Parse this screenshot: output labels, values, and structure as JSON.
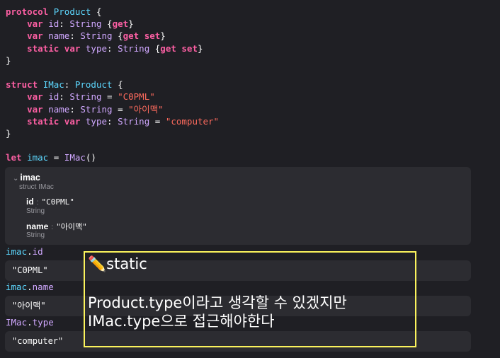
{
  "code_lines": [
    [
      [
        "kw",
        "protocol"
      ],
      [
        "plain",
        " "
      ],
      [
        "type",
        "Product"
      ],
      [
        "plain",
        " {"
      ]
    ],
    [
      [
        "plain",
        "    "
      ],
      [
        "kw",
        "var"
      ],
      [
        "plain",
        " "
      ],
      [
        "prop",
        "id"
      ],
      [
        "plain",
        ": "
      ],
      [
        "prop",
        "String"
      ],
      [
        "plain",
        " {"
      ],
      [
        "kw",
        "get"
      ],
      [
        "plain",
        "}"
      ]
    ],
    [
      [
        "plain",
        "    "
      ],
      [
        "kw",
        "var"
      ],
      [
        "plain",
        " "
      ],
      [
        "prop",
        "name"
      ],
      [
        "plain",
        ": "
      ],
      [
        "prop",
        "String"
      ],
      [
        "plain",
        " {"
      ],
      [
        "kw",
        "get set"
      ],
      [
        "plain",
        "}"
      ]
    ],
    [
      [
        "plain",
        "    "
      ],
      [
        "kw",
        "static var"
      ],
      [
        "plain",
        " "
      ],
      [
        "prop",
        "type"
      ],
      [
        "plain",
        ": "
      ],
      [
        "prop",
        "String"
      ],
      [
        "plain",
        " {"
      ],
      [
        "kw",
        "get set"
      ],
      [
        "plain",
        "}"
      ]
    ],
    [
      [
        "plain",
        "}"
      ]
    ],
    [
      [
        "plain",
        ""
      ]
    ],
    [
      [
        "kw",
        "struct"
      ],
      [
        "plain",
        " "
      ],
      [
        "type",
        "IMac"
      ],
      [
        "plain",
        ": "
      ],
      [
        "type",
        "Product"
      ],
      [
        "plain",
        " {"
      ]
    ],
    [
      [
        "plain",
        "    "
      ],
      [
        "kw",
        "var"
      ],
      [
        "plain",
        " "
      ],
      [
        "prop",
        "id"
      ],
      [
        "plain",
        ": "
      ],
      [
        "prop",
        "String"
      ],
      [
        "plain",
        " = "
      ],
      [
        "str",
        "\"C0PML\""
      ]
    ],
    [
      [
        "plain",
        "    "
      ],
      [
        "kw",
        "var"
      ],
      [
        "plain",
        " "
      ],
      [
        "prop",
        "name"
      ],
      [
        "plain",
        ": "
      ],
      [
        "prop",
        "String"
      ],
      [
        "plain",
        " = "
      ],
      [
        "str",
        "\"아이맥\""
      ]
    ],
    [
      [
        "plain",
        "    "
      ],
      [
        "kw",
        "static var"
      ],
      [
        "plain",
        " "
      ],
      [
        "prop",
        "type"
      ],
      [
        "plain",
        ": "
      ],
      [
        "prop",
        "String"
      ],
      [
        "plain",
        " = "
      ],
      [
        "str",
        "\"computer\""
      ]
    ],
    [
      [
        "plain",
        "}"
      ]
    ],
    [
      [
        "plain",
        ""
      ]
    ],
    [
      [
        "kw",
        "let"
      ],
      [
        "plain",
        " "
      ],
      [
        "type",
        "imac"
      ],
      [
        "plain",
        " = "
      ],
      [
        "prop",
        "IMac"
      ],
      [
        "plain",
        "()"
      ]
    ]
  ],
  "inspector": {
    "title": "imac",
    "subtitle": "struct IMac",
    "properties": [
      {
        "name": "id",
        "value": "\"C0PML\"",
        "type": "String"
      },
      {
        "name": "name",
        "value": "\"아이맥\"",
        "type": "String"
      }
    ]
  },
  "results": [
    {
      "expr_a": "imac",
      "expr_b": "id",
      "value": "\"C0PML\""
    },
    {
      "expr_a": "imac",
      "expr_b": "name",
      "value": "\"아이맥\""
    },
    {
      "expr_a": "IMac",
      "expr_b": "type",
      "value": "\"computer\""
    }
  ],
  "note": {
    "heading": "✏️static",
    "line1": "Product.type이라고 생각할 수 있겠지만",
    "line2": "IMac.type으로 접근해야한다"
  },
  "colors": {
    "background": "#1f1f24",
    "keyword": "#fc5fa3",
    "type": "#5dd8ff",
    "property": "#d0a8ff",
    "string": "#fc6a5d",
    "note_border": "#fbf35c"
  }
}
